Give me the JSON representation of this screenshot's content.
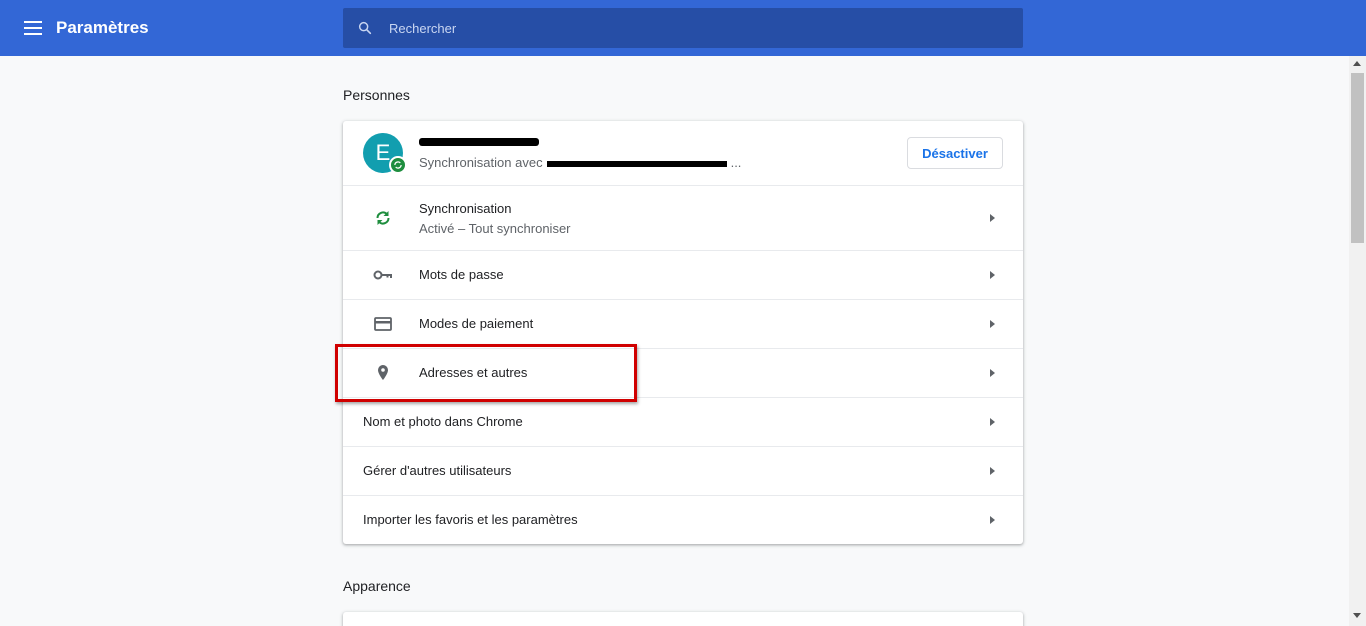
{
  "header": {
    "title": "Paramètres",
    "search_placeholder": "Rechercher"
  },
  "people": {
    "section_title": "Personnes",
    "account": {
      "avatar_letter": "E",
      "sync_prefix": "Synchronisation avec",
      "sync_suffix": "...",
      "deactivate_label": "Désactiver"
    },
    "items": [
      {
        "label": "Synchronisation",
        "sublabel": "Activé – Tout synchroniser",
        "icon": "sync-icon"
      },
      {
        "label": "Mots de passe",
        "icon": "key-icon"
      },
      {
        "label": "Modes de paiement",
        "icon": "credit-card-icon"
      },
      {
        "label": "Adresses et autres",
        "icon": "location-pin-icon"
      },
      {
        "label": "Nom et photo dans Chrome"
      },
      {
        "label": "Gérer d'autres utilisateurs"
      },
      {
        "label": "Importer les favoris et les paramètres"
      }
    ]
  },
  "appearance": {
    "section_title": "Apparence"
  },
  "colors": {
    "topbar": "#3367d6",
    "search_bg": "#264ea6",
    "accent_blue": "#1a73e8",
    "sync_green": "#1e8e3e",
    "avatar_teal": "#129eaf",
    "highlight_red": "#d00000"
  }
}
